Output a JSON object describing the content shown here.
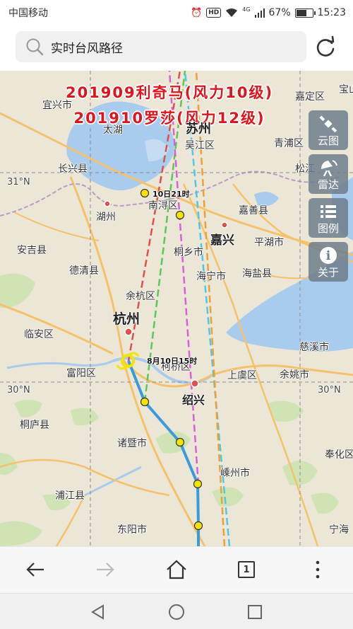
{
  "status": {
    "carrier": "中国移动",
    "network": "4G",
    "battery": "67%",
    "battery_level": 0.67,
    "time": "15:23"
  },
  "search": {
    "text": "实时台风路径"
  },
  "map": {
    "titles": [
      "201909利奇马(风力10级)",
      "201910罗莎(风力12级)"
    ],
    "cities": [
      "太湖",
      "苏州",
      "吴江区",
      "长兴县",
      "湖州",
      "南浔区",
      "嘉善县",
      "嘉兴",
      "青浦区",
      "松江",
      "安吉县",
      "德清县",
      "桐乡市",
      "平湖市",
      "海宁市",
      "海盐县",
      "余杭区",
      "杭州",
      "临安区",
      "富阳区",
      "柯桥区",
      "上虞区",
      "绍兴",
      "慈溪市",
      "余姚市",
      "桐庐县",
      "诸暨市",
      "嵊州市",
      "奉化区",
      "浦江县",
      "东阳市",
      "宁海",
      "嘉定区",
      "宝山",
      "宜兴市"
    ],
    "lat_labels": [
      "31°N",
      "30°N",
      "30°N"
    ],
    "time_labels": [
      "10日21时",
      "8月10日15时"
    ]
  },
  "side_buttons": [
    {
      "label": "云图",
      "icon": "satellite-icon"
    },
    {
      "label": "雷达",
      "icon": "radar-icon"
    },
    {
      "label": "图例",
      "icon": "legend-list-icon"
    },
    {
      "label": "关于",
      "icon": "info-icon"
    }
  ],
  "toolbar": {
    "tab_count": "1"
  },
  "colors": {
    "title": "#e0141a",
    "track_actual": "#3a9bdc",
    "point": "#f5e400",
    "forecast_red": "#e0504a",
    "forecast_green": "#5ac85a",
    "forecast_magenta": "#d860d8",
    "forecast_cyan": "#4cc8e8",
    "forecast_orange": "#f0a030"
  }
}
